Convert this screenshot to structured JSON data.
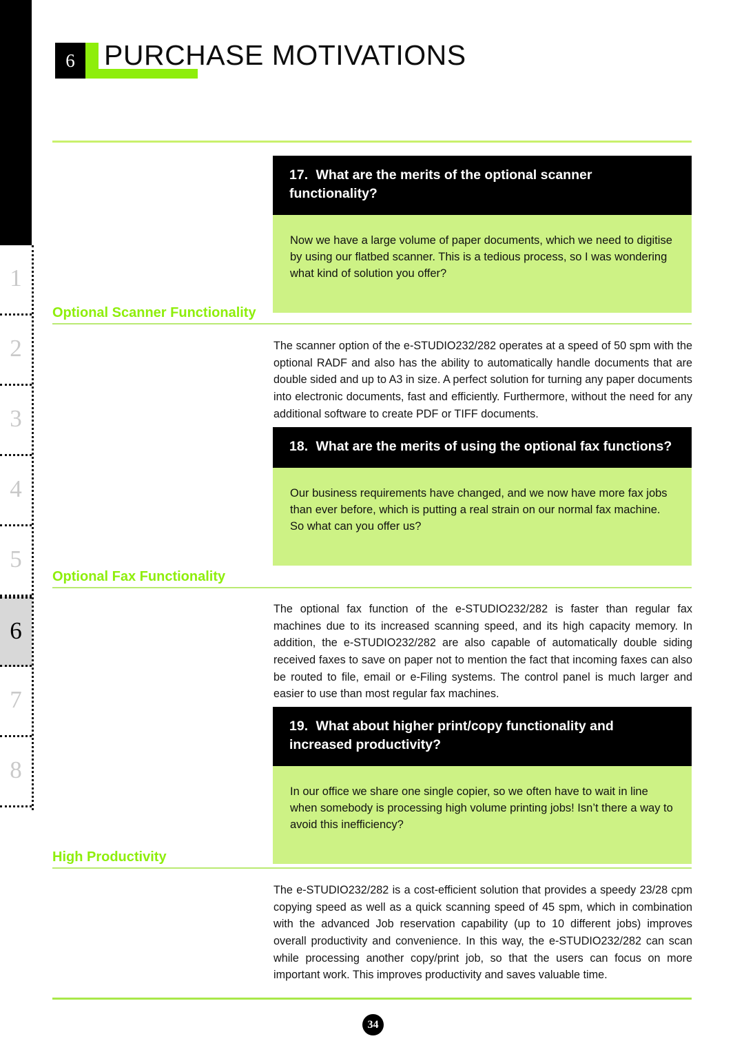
{
  "header": {
    "chapter_number": "6",
    "title": "PURCHASE MOTIVATIONS",
    "accent_green": "#8eee0b",
    "badge_bg": "#000000"
  },
  "sidebar": {
    "active_index": 5,
    "items": [
      {
        "label": "1"
      },
      {
        "label": "2"
      },
      {
        "label": "3"
      },
      {
        "label": "4"
      },
      {
        "label": "5"
      },
      {
        "label": "6"
      },
      {
        "label": "7"
      },
      {
        "label": "8"
      }
    ]
  },
  "qa_blocks": [
    {
      "number": "17.",
      "question": "What are the merits of the optional scanner functionality?",
      "answer": "Now we have a large volume of paper documents, which we need to digitise by using our flatbed scanner. This is a tedious process, so I was wondering what kind of solution you offer?"
    },
    {
      "number": "18.",
      "question": "What are the merits of using the optional fax functions?",
      "answer": "Our business requirements have changed, and we now have more fax jobs than ever before, which is putting a real strain on our normal fax machine. So what can you offer us?"
    },
    {
      "number": "19.",
      "question": "What about higher print/copy functionality and increased productivity?",
      "answer": "In our office we share one single copier, so we often have to wait in line when somebody is processing high volume printing jobs! Isn’t there a way to avoid this inefficiency?"
    }
  ],
  "sections": [
    {
      "heading": "Optional Scanner Functionality",
      "body": "The scanner option of the e-STUDIO232/282 operates at a speed of 50 spm with the optional RADF and also has the ability to automatically handle documents that are double sided and up to A3 in size. A perfect solution for turning any paper documents into electronic documents, fast and efficiently. Furthermore, without the need for any additional software to create PDF or TIFF documents."
    },
    {
      "heading": "Optional Fax Functionality",
      "body": "The optional fax function of the e-STUDIO232/282 is faster than regular fax machines due to its increased scanning speed, and its high capacity memory. In addition, the e-STUDIO232/282 are also capable of automatically double siding received faxes to save on paper not to mention the fact that incoming faxes can also be routed to file, email or e-Filing systems. The control panel is much larger and easier to use than most regular fax machines."
    },
    {
      "heading": "High Productivity",
      "body": "The e-STUDIO232/282 is a cost-efficient solution that provides a speedy 23/28 cpm copying speed as well as a quick scanning speed of 45 spm, which in combination with the advanced Job reservation capability (up to 10 different jobs) improves overall productivity and convenience. In this way, the e-STUDIO232/282 can scan while processing another copy/print job, so that the users can focus on more important work. This improves productivity and saves valuable time."
    }
  ],
  "footer": {
    "page_number": "34"
  },
  "colors": {
    "accent_bright_green": "#8eee0b",
    "answer_block_green": "#cdf285",
    "rule_green": "#c9f06c",
    "sidebar_active_gray": "#d8d8d8",
    "sidebar_inactive_text": "#c9c9c9"
  }
}
